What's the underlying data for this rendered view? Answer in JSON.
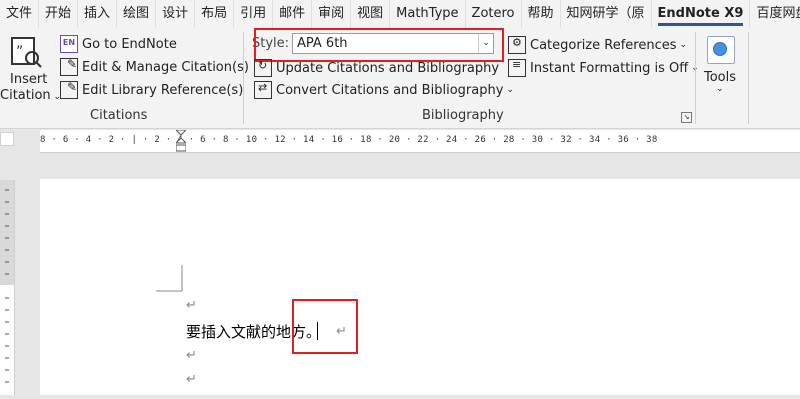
{
  "tabs": [
    "文件",
    "开始",
    "插入",
    "绘图",
    "设计",
    "布局",
    "引用",
    "邮件",
    "审阅",
    "视图",
    "MathType",
    "Zotero",
    "帮助",
    "知网研学（原",
    "EndNote X9",
    "百度网盘"
  ],
  "citations": {
    "insert_label_1": "Insert",
    "insert_label_2": "Citation",
    "go_to_endnote": "Go to EndNote",
    "edit_manage": "Edit & Manage Citation(s)",
    "edit_library": "Edit Library Reference(s)",
    "group_label": "Citations"
  },
  "bibliography": {
    "style_label": "Style:",
    "style_value": "APA 6th",
    "update": "Update Citations and Bibliography",
    "convert": "Convert Citations and Bibliography",
    "categorize": "Categorize References",
    "instant_formatting": "Instant Formatting is Off",
    "group_label": "Bibliography"
  },
  "tools": {
    "label": "Tools"
  },
  "ruler": {
    "ticks": "8 · 6 · 4 · 2 · | · 2 · 4 · 6 · 8 · 10 · 12 · 14 · 16 · 18 · 20 · 22 · 24 · 26 · 28 · 30 · 32 · 34 · 36 · 38"
  },
  "document": {
    "line_text": "要插入文献的地方。",
    "para_mark": "↵"
  },
  "colors": {
    "accent": "#2b579a",
    "highlight": "#e02020"
  }
}
